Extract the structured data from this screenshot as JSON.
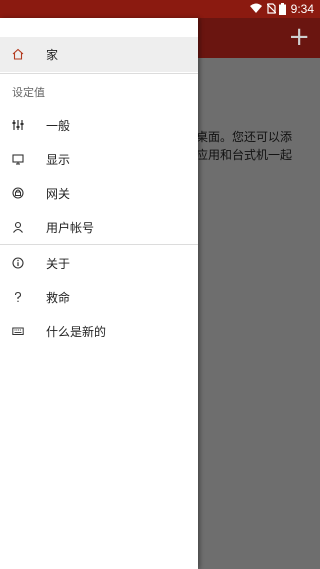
{
  "status_bar": {
    "time": "9:34",
    "icons": [
      "wifi-icon",
      "no-sim-icon",
      "battery-icon"
    ]
  },
  "app": {
    "add_icon": "plus-icon",
    "description_lines": [
      "桌面。您还可以添",
      "应用和台式机一起"
    ]
  },
  "drawer": {
    "home": {
      "label": "家",
      "icon": "home-icon"
    },
    "section_title": "设定值",
    "settings_items": [
      {
        "label": "一般",
        "icon": "sliders-icon"
      },
      {
        "label": "显示",
        "icon": "monitor-icon"
      },
      {
        "label": "网关",
        "icon": "gateway-icon"
      },
      {
        "label": "用户帐号",
        "icon": "user-icon"
      }
    ],
    "other_items": [
      {
        "label": "关于",
        "icon": "info-icon"
      },
      {
        "label": "救命",
        "icon": "help-icon"
      },
      {
        "label": "什么是新的",
        "icon": "keyboard-icon"
      }
    ]
  },
  "colors": {
    "accent": "#b33a1e",
    "status_bar": "#8b1a10",
    "app_bar": "#6a1510"
  }
}
